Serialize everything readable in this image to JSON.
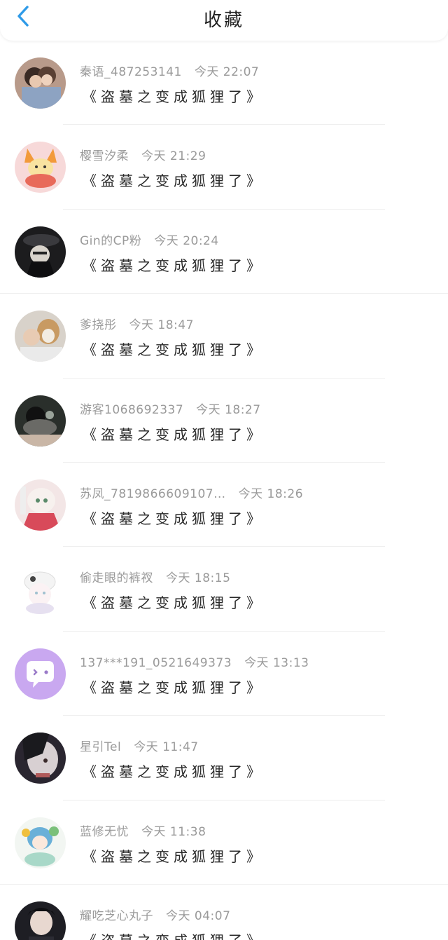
{
  "header": {
    "title": "收藏"
  },
  "items": [
    {
      "user": "秦语_487253141",
      "time": "今天 22:07",
      "book": "《盗墓之变成狐狸了》"
    },
    {
      "user": "樱雪汐柔",
      "time": "今天 21:29",
      "book": "《盗墓之变成狐狸了》"
    },
    {
      "user": "Gin的CP粉",
      "time": "今天 20:24",
      "book": "《盗墓之变成狐狸了》"
    },
    {
      "user": "爹挠彤",
      "time": "今天 18:47",
      "book": "《盗墓之变成狐狸了》"
    },
    {
      "user": "游客1068692337",
      "time": "今天 18:27",
      "book": "《盗墓之变成狐狸了》"
    },
    {
      "user": "苏凤_7819866609107…",
      "time": "今天 18:26",
      "book": "《盗墓之变成狐狸了》"
    },
    {
      "user": "偷走眼的裤衩",
      "time": "今天 18:15",
      "book": "《盗墓之变成狐狸了》"
    },
    {
      "user": "137***191_0521649373",
      "time": "今天 13:13",
      "book": "《盗墓之变成狐狸了》"
    },
    {
      "user": "星引Tel",
      "time": "今天 11:47",
      "book": "《盗墓之变成狐狸了》"
    },
    {
      "user": "蓝修无忧",
      "time": "今天 11:38",
      "book": "《盗墓之变成狐狸了》"
    },
    {
      "user": "耀吃芝心丸子",
      "time": "今天 04:07",
      "book": "《盗墓之变成狐狸了》"
    }
  ],
  "colors": {
    "accent": "#2f9be8",
    "meta_text": "#9a9a9a",
    "chat_avatar": "#c9a8f0"
  }
}
